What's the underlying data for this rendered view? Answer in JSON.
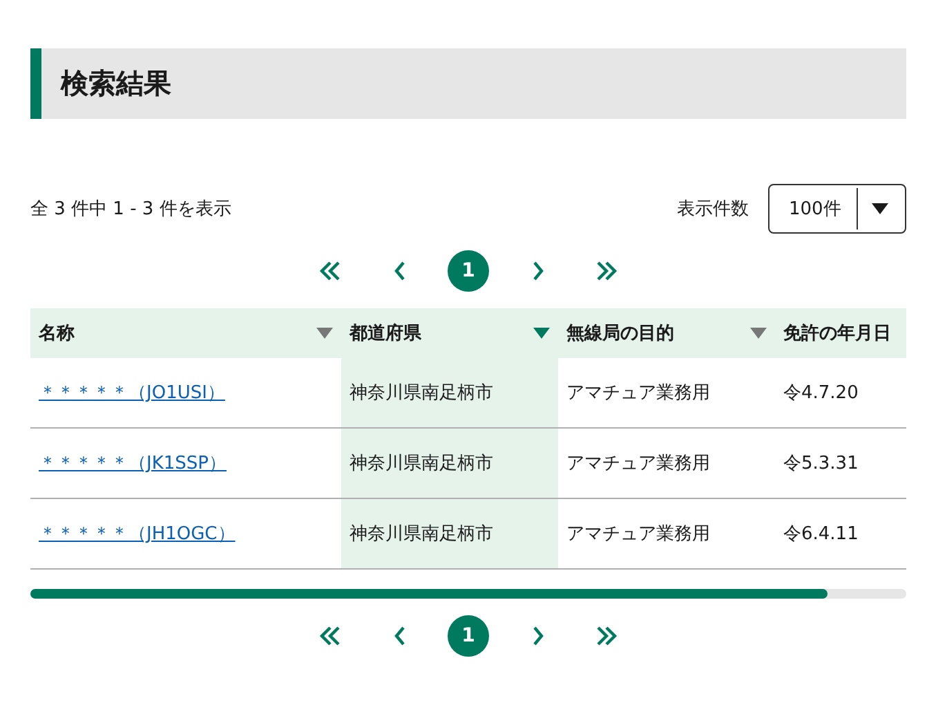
{
  "heading": "検索結果",
  "summary": "全 3 件中 1 - 3 件を表示",
  "page_size": {
    "label": "表示件数",
    "value": "100件"
  },
  "pagination_top": {
    "pages": [
      {
        "label": "1",
        "selected": true
      }
    ]
  },
  "table": {
    "columns": [
      {
        "label": "名称",
        "sorted": false
      },
      {
        "label": "都道府県",
        "sorted": true
      },
      {
        "label": "無線局の目的",
        "sorted": false
      },
      {
        "label": "免許の年月日",
        "sorted": false
      }
    ],
    "rows": [
      [
        "＊＊＊＊＊（JO1USI）",
        "神奈川県南足柄市",
        "アマチュア業務用",
        "令4.7.20"
      ],
      [
        "＊＊＊＊＊（JK1SSP）",
        "神奈川県南足柄市",
        "アマチュア業務用",
        "令5.3.31"
      ],
      [
        "＊＊＊＊＊（JH1OGC）",
        "神奈川県南足柄市",
        "アマチュア業務用",
        "令6.4.11"
      ]
    ]
  },
  "pagination_bottom": {
    "pages": [
      {
        "label": "1",
        "selected": true
      }
    ]
  }
}
